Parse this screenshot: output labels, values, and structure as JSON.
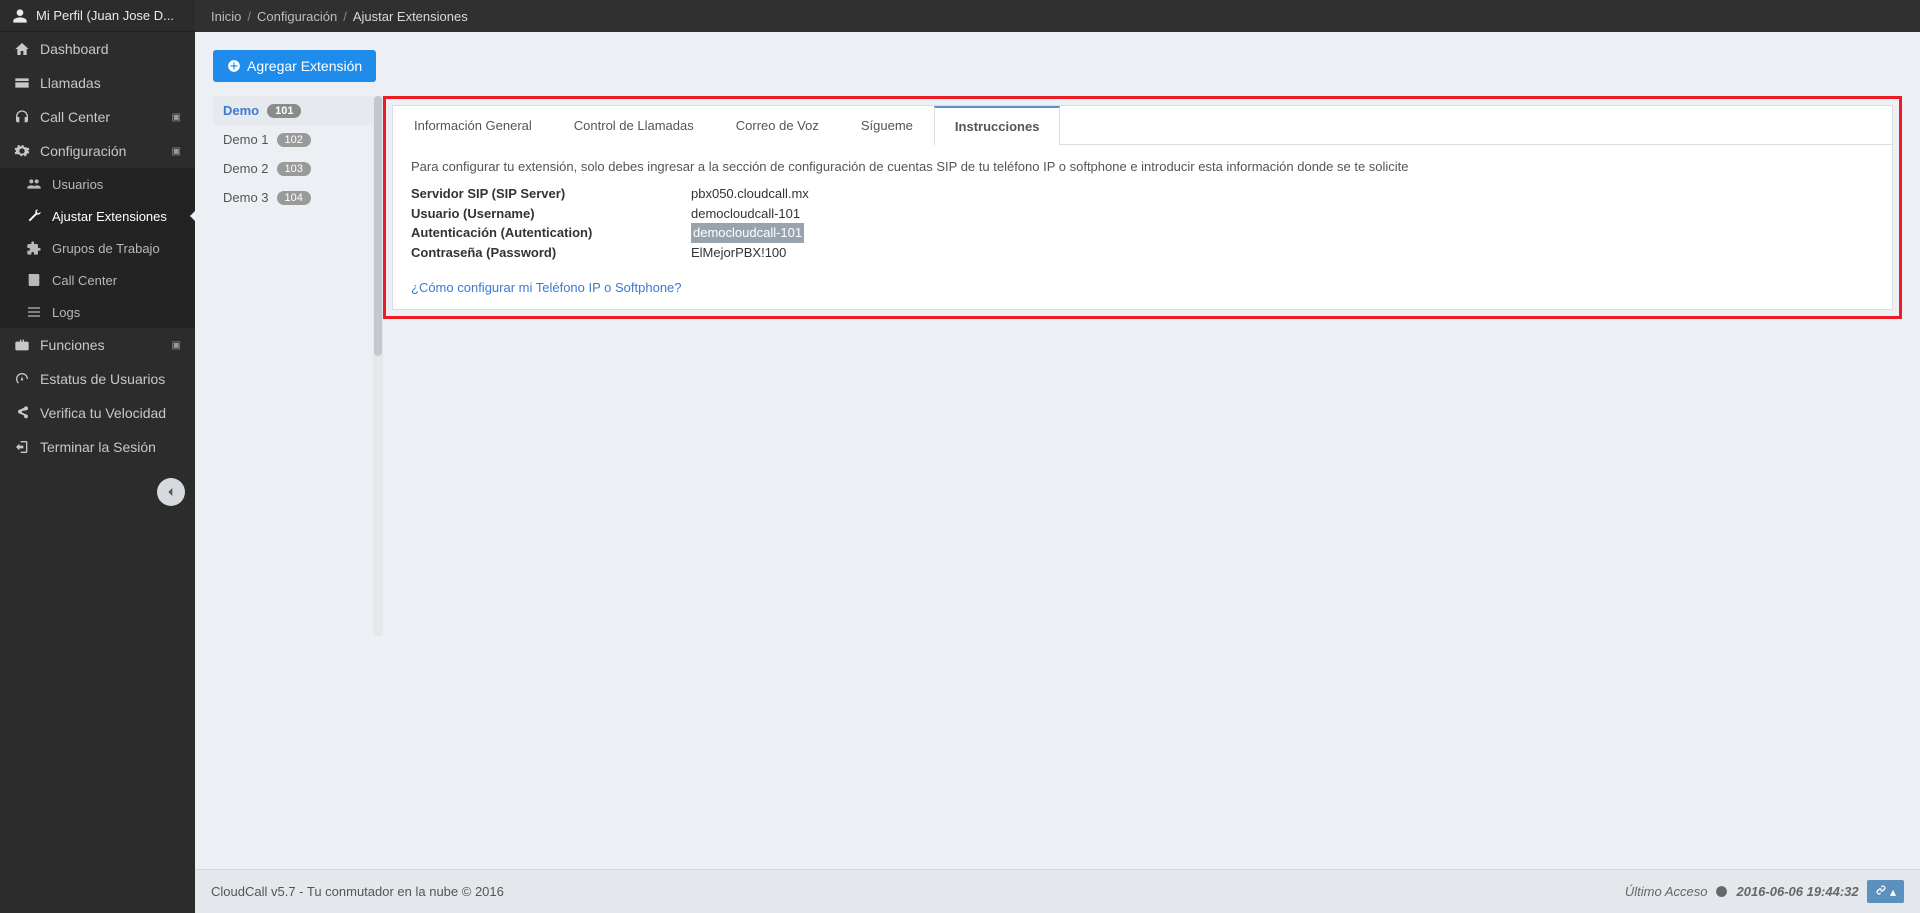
{
  "profile": {
    "label": "Mi Perfil (Juan Jose D..."
  },
  "sidebar": {
    "items": [
      {
        "label": "Dashboard"
      },
      {
        "label": "Llamadas"
      },
      {
        "label": "Call Center"
      },
      {
        "label": "Configuración"
      },
      {
        "label": "Funciones"
      },
      {
        "label": "Estatus de Usuarios"
      },
      {
        "label": "Verifica tu Velocidad"
      },
      {
        "label": "Terminar la Sesión"
      }
    ],
    "config_sub": [
      {
        "label": "Usuarios"
      },
      {
        "label": "Ajustar Extensiones"
      },
      {
        "label": "Grupos de Trabajo"
      },
      {
        "label": "Call Center"
      },
      {
        "label": "Logs"
      }
    ]
  },
  "breadcrumb": {
    "home": "Inicio",
    "config": "Configuración",
    "current": "Ajustar Extensiones"
  },
  "actions": {
    "add_extension": "Agregar Extensión"
  },
  "extensions": [
    {
      "name": "Demo",
      "num": "101",
      "active": true
    },
    {
      "name": "Demo 1",
      "num": "102",
      "active": false
    },
    {
      "name": "Demo 2",
      "num": "103",
      "active": false
    },
    {
      "name": "Demo 3",
      "num": "104",
      "active": false
    }
  ],
  "tabs": [
    {
      "label": "Información General"
    },
    {
      "label": "Control de Llamadas"
    },
    {
      "label": "Correo de Voz"
    },
    {
      "label": "Sígueme"
    },
    {
      "label": "Instrucciones"
    }
  ],
  "instructions": {
    "intro": "Para configurar tu extensión, solo debes ingresar a la sección de configuración de cuentas SIP de tu teléfono IP o softphone e introducir esta información donde se te solicite",
    "rows": {
      "server_label": "Servidor SIP (SIP Server)",
      "server_value": "pbx050.cloudcall.mx",
      "user_label": "Usuario (Username)",
      "user_value": "democloudcall-101",
      "auth_label": "Autenticación (Autentication)",
      "auth_value": "democloudcall-101",
      "pass_label": "Contraseña (Password)",
      "pass_value": "ElMejorPBX!100"
    },
    "help_link": "¿Cómo configurar mi Teléfono IP o Softphone?"
  },
  "footer": {
    "left": "CloudCall v5.7 - Tu conmutador en la nube © 2016",
    "right_prefix": "Último Acceso",
    "right_time": "2016-06-06 19:44:32"
  }
}
